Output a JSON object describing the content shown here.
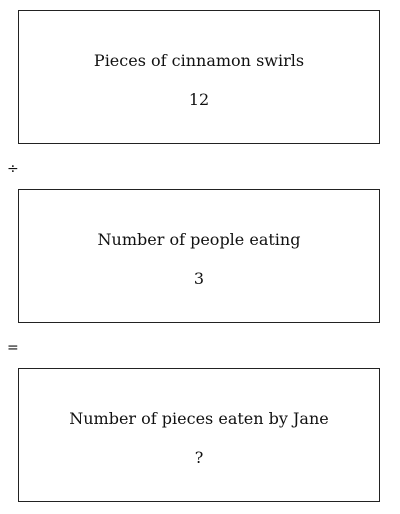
{
  "boxes": [
    {
      "label": "Pieces of cinnamon swirls",
      "value": "12"
    },
    {
      "label": "Number of people eating",
      "value": "3"
    },
    {
      "label": "Number of pieces eaten by Jane",
      "value": "?"
    }
  ],
  "operators": [
    "÷",
    "="
  ]
}
